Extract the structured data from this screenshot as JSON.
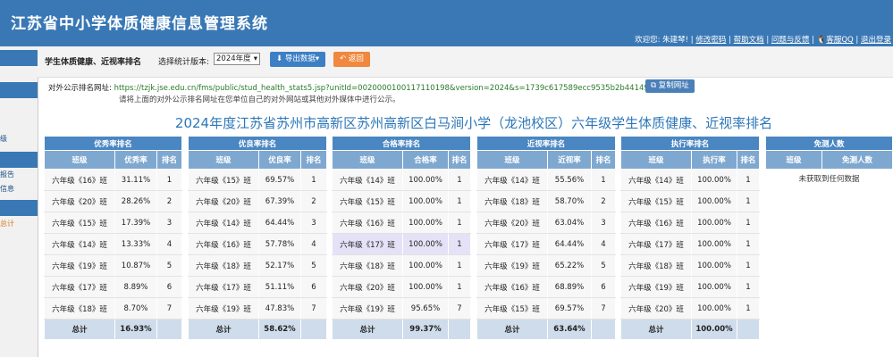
{
  "header": {
    "app_title": "江苏省中小学体质健康信息管理系统",
    "welcome": "欢迎您: 朱建琴!",
    "links": [
      "修改密码",
      "帮助文档",
      "问题与反馈",
      "客服QQ",
      "退出登录"
    ]
  },
  "sidebar": {
    "items": [
      "级",
      "报告",
      "信息",
      "总计"
    ]
  },
  "toolbar": {
    "title": "学生体质健康、近视率排名",
    "version_label": "选择统计版本:",
    "version_value": "2024年度",
    "export_label": "导出数据",
    "back_label": "返回"
  },
  "public": {
    "label": "对外公示排名网址:",
    "url": "https://tzjk.jse.edu.cn/fms/public/stud_health_stats5.jsp?unitId=0020000100117110198&version=2024&s=1739c617589ecc9535b2b44149c87b41",
    "copy_label": "复制网址",
    "note": "请将上面的对外公示排名网址在您单位自己的对外网站或其他对外媒体中进行公示。"
  },
  "main_title": "2024年度江苏省苏州市高新区苏州高新区白马涧小学（龙池校区）六年级学生体质健康、近视率排名",
  "tables": [
    {
      "caption": "优秀率排名",
      "headers": [
        "班级",
        "优秀率",
        "排名"
      ],
      "rows": [
        [
          "六年级《16》班",
          "31.11%",
          "1"
        ],
        [
          "六年级《20》班",
          "28.26%",
          "2"
        ],
        [
          "六年级《15》班",
          "17.39%",
          "3"
        ],
        [
          "六年级《14》班",
          "13.33%",
          "4"
        ],
        [
          "六年级《19》班",
          "10.87%",
          "5"
        ],
        [
          "六年级《17》班",
          "8.89%",
          "6"
        ],
        [
          "六年级《18》班",
          "8.70%",
          "7"
        ]
      ],
      "total_label": "总计",
      "total_value": "16.93%"
    },
    {
      "caption": "优良率排名",
      "headers": [
        "班级",
        "优良率",
        "排名"
      ],
      "rows": [
        [
          "六年级《15》班",
          "69.57%",
          "1"
        ],
        [
          "六年级《20》班",
          "67.39%",
          "2"
        ],
        [
          "六年级《14》班",
          "64.44%",
          "3"
        ],
        [
          "六年级《16》班",
          "57.78%",
          "4"
        ],
        [
          "六年级《18》班",
          "52.17%",
          "5"
        ],
        [
          "六年级《17》班",
          "51.11%",
          "6"
        ],
        [
          "六年级《19》班",
          "47.83%",
          "7"
        ]
      ],
      "total_label": "总计",
      "total_value": "58.62%"
    },
    {
      "caption": "合格率排名",
      "headers": [
        "班级",
        "合格率",
        "排名"
      ],
      "rows": [
        [
          "六年级《14》班",
          "100.00%",
          "1"
        ],
        [
          "六年级《15》班",
          "100.00%",
          "1"
        ],
        [
          "六年级《16》班",
          "100.00%",
          "1"
        ],
        [
          "六年级《17》班",
          "100.00%",
          "1"
        ],
        [
          "六年级《18》班",
          "100.00%",
          "1"
        ],
        [
          "六年级《20》班",
          "100.00%",
          "1"
        ],
        [
          "六年级《19》班",
          "95.65%",
          "7"
        ]
      ],
      "total_label": "总计",
      "total_value": "99.37%"
    },
    {
      "caption": "近视率排名",
      "headers": [
        "班级",
        "近视率",
        "排名"
      ],
      "rows": [
        [
          "六年级《14》班",
          "55.56%",
          "1"
        ],
        [
          "六年级《18》班",
          "58.70%",
          "2"
        ],
        [
          "六年级《20》班",
          "63.04%",
          "3"
        ],
        [
          "六年级《17》班",
          "64.44%",
          "4"
        ],
        [
          "六年级《19》班",
          "65.22%",
          "5"
        ],
        [
          "六年级《16》班",
          "68.89%",
          "6"
        ],
        [
          "六年级《15》班",
          "69.57%",
          "7"
        ]
      ],
      "total_label": "总计",
      "total_value": "63.64%"
    },
    {
      "caption": "执行率排名",
      "headers": [
        "班级",
        "执行率",
        "排名"
      ],
      "rows": [
        [
          "六年级《14》班",
          "100.00%",
          "1"
        ],
        [
          "六年级《15》班",
          "100.00%",
          "1"
        ],
        [
          "六年级《16》班",
          "100.00%",
          "1"
        ],
        [
          "六年级《17》班",
          "100.00%",
          "1"
        ],
        [
          "六年级《18》班",
          "100.00%",
          "1"
        ],
        [
          "六年级《19》班",
          "100.00%",
          "1"
        ],
        [
          "六年级《20》班",
          "100.00%",
          "1"
        ]
      ],
      "total_label": "总计",
      "total_value": "100.00%"
    },
    {
      "caption": "免测人数",
      "headers": [
        "班级",
        "免测人数"
      ],
      "empty_text": "未获取到任何数据"
    }
  ],
  "colors": {
    "header_bg": "#3a78b5",
    "table_caption": "#4a86c1",
    "table_header": "#7fa8d0",
    "title_text": "#2c77b8",
    "export_button": "#3d7fc4",
    "back_button": "#f0883e",
    "highlight_row": "#e5e2f7"
  }
}
